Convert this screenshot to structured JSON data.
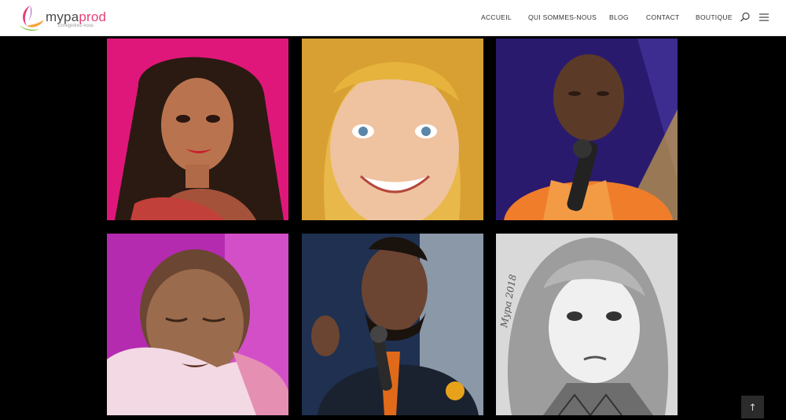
{
  "brand": {
    "name_prefix": "mypa",
    "name_suffix": "prod",
    "tagline": "Enregistrez-vous",
    "accent_color": "#e2407a"
  },
  "nav": {
    "items": [
      {
        "label": "ACCUEIL"
      },
      {
        "label": "QUI SOMMES-NOUS"
      },
      {
        "label": "BLOG"
      },
      {
        "label": "CONTACT"
      },
      {
        "label": "BOUTIQUE"
      }
    ],
    "search_icon": "search-icon",
    "menu_icon": "hamburger-menu-icon"
  },
  "gallery": {
    "tiles": [
      {
        "subject": "portrait-woman-braids",
        "background": "#e0177a"
      },
      {
        "subject": "portrait-blonde-woman",
        "background": "#e8b94a"
      },
      {
        "subject": "portrait-man-singing",
        "background": "#2a1a6e"
      },
      {
        "subject": "portrait-baby",
        "background": "#b42bb0"
      },
      {
        "subject": "portrait-man-microphone",
        "background": "#1f3050"
      },
      {
        "subject": "portrait-child-sketch",
        "background": "#d9d9d9",
        "signature": "Mypa 2018"
      }
    ]
  },
  "scroll_top": {
    "label": "↑",
    "icon": "arrow-up-icon"
  }
}
